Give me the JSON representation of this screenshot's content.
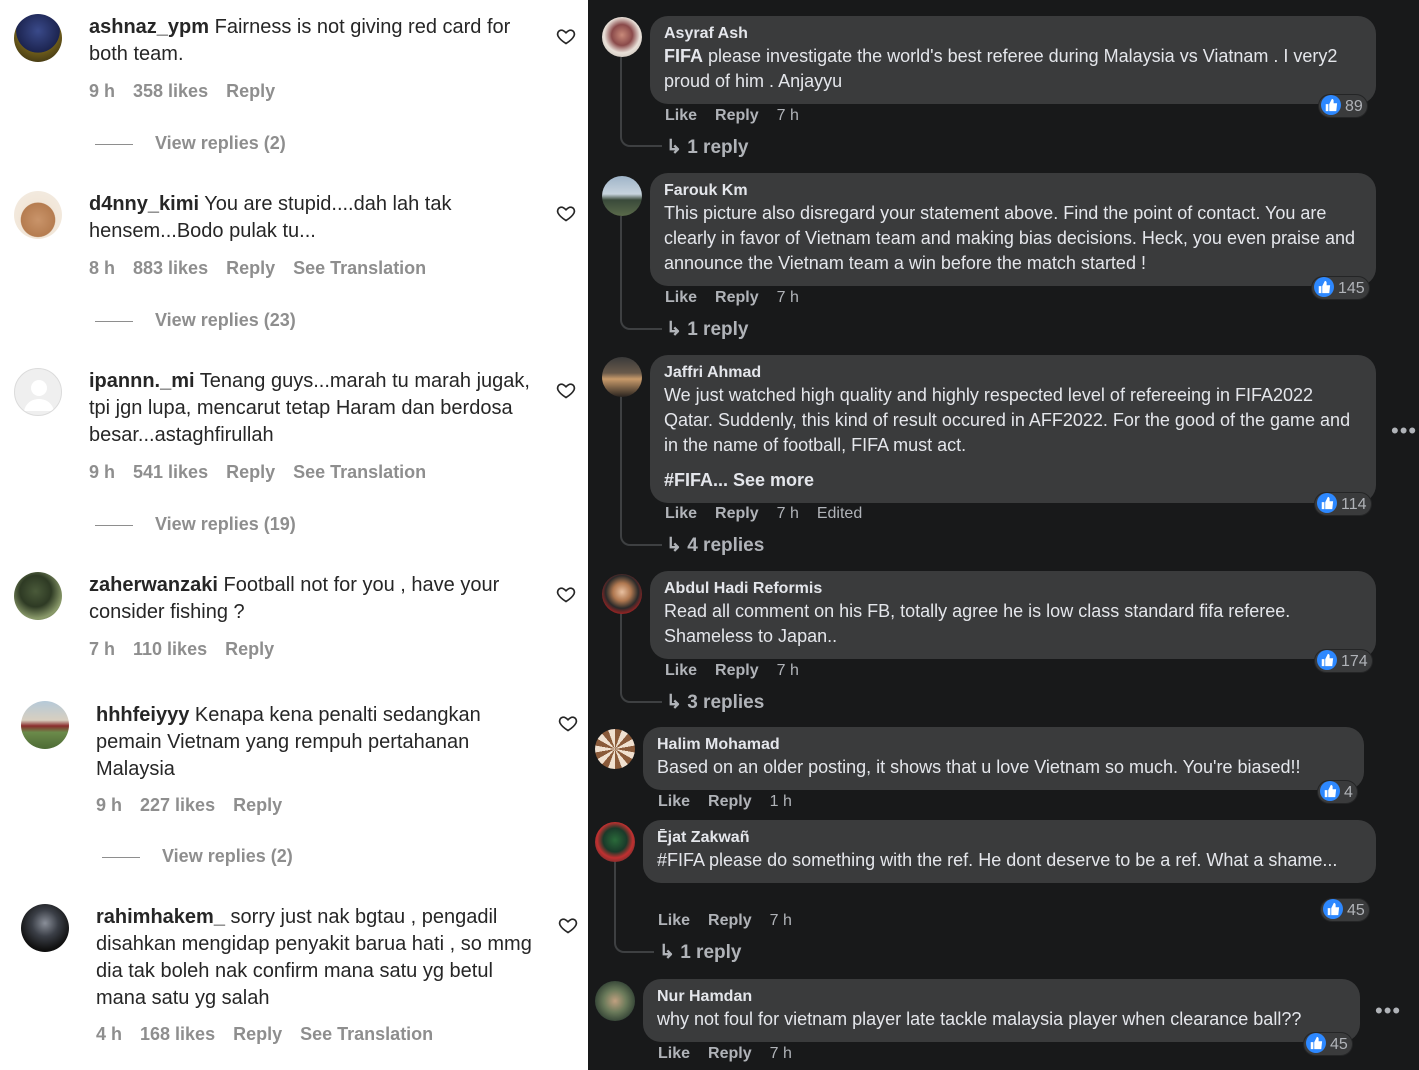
{
  "instagram": {
    "comments": [
      {
        "user": "ashnaz_ypm",
        "text": "Fairness is not giving red card for both team.",
        "time": "9 h",
        "likes": "358 likes",
        "reply": "Reply",
        "translation": "",
        "view_replies": "View replies (2)"
      },
      {
        "user": "d4nny_kimi",
        "text": "You are stupid....dah lah tak hensem...Bodo pulak tu...",
        "time": "8 h",
        "likes": "883 likes",
        "reply": "Reply",
        "translation": "See Translation",
        "view_replies": "View replies (23)"
      },
      {
        "user": "ipannn._mi",
        "text": "Tenang guys...marah tu marah jugak, tpi jgn lupa, mencarut tetap Haram dan berdosa besar...astaghfirullah",
        "time": "9 h",
        "likes": "541 likes",
        "reply": "Reply",
        "translation": "See Translation",
        "view_replies": "View replies (19)"
      },
      {
        "user": "zaherwanzaki",
        "text": "Football not for you , have your consider fishing ?",
        "time": "7 h",
        "likes": "110 likes",
        "reply": "Reply",
        "translation": "",
        "view_replies": ""
      },
      {
        "user": "hhhfeiyyy",
        "text": "Kenapa kena penalti sedangkan pemain Vietnam yang rempuh pertahanan Malaysia",
        "time": "9 h",
        "likes": "227 likes",
        "reply": "Reply",
        "translation": "",
        "view_replies": "View replies (2)"
      },
      {
        "user": "rahimhakem_",
        "text": "sorry just nak bgtau , pengadil disahkan mengidap penyakit barua hati , so mmg dia tak boleh nak confirm mana satu yg betul mana satu yg salah",
        "time": "4 h",
        "likes": "168 likes",
        "reply": "Reply",
        "translation": "See Translation",
        "view_replies": ""
      }
    ]
  },
  "facebook": {
    "comments": [
      {
        "name": "Asyraf Ash",
        "bold_prefix": "FIFA",
        "text": " please investigate the world's best referee during Malaysia vs Viatnam . I very2 proud of him . Anjayyu",
        "extra": "",
        "like": "Like",
        "reply": "Reply",
        "time": "7 h",
        "edited": "",
        "reactions": "89",
        "replies": "1 reply"
      },
      {
        "name": "Farouk Km",
        "bold_prefix": "",
        "text": "This picture also disregard your statement above. Find the point of contact. You are clearly in favor of Vietnam team and making bias decisions. Heck, you even praise and announce the Vietnam team a win before the match started !",
        "extra": "",
        "like": "Like",
        "reply": "Reply",
        "time": "7 h",
        "edited": "",
        "reactions": "145",
        "replies": "1 reply"
      },
      {
        "name": "Jaffri Ahmad",
        "bold_prefix": "",
        "text": "We just watched high quality and highly respected level of refereeing in FIFA2022 Qatar. Suddenly, this kind of result occured in AFF2022. For the good of the game and in the name of football, FIFA must act.",
        "extra": "#FIFA... See more",
        "like": "Like",
        "reply": "Reply",
        "time": "7 h",
        "edited": "Edited",
        "reactions": "114",
        "replies": "4 replies"
      },
      {
        "name": "Abdul Hadi Reformis",
        "bold_prefix": "",
        "text": "Read all comment on his FB, totally agree he is low class standard fifa referee. Shameless to Japan..",
        "extra": "",
        "like": "Like",
        "reply": "Reply",
        "time": "7 h",
        "edited": "",
        "reactions": "174",
        "replies": "3 replies"
      },
      {
        "name": "Halim Mohamad",
        "bold_prefix": "",
        "text": "Based on an older posting, it shows that u love Vietnam so much. You're biased!!",
        "extra": "",
        "like": "Like",
        "reply": "Reply",
        "time": "1 h",
        "edited": "",
        "reactions": "4",
        "replies": ""
      },
      {
        "name": "Ējat Zakwañ",
        "bold_prefix": "#FIFA",
        "text": " please do something with the ref. He dont deserve to be a ref. What a shame...",
        "extra": "",
        "like": "Like",
        "reply": "Reply",
        "time": "7 h",
        "edited": "",
        "reactions": "45",
        "replies": "1 reply"
      },
      {
        "name": "Nur Hamdan",
        "bold_prefix": "",
        "text": "why not foul for vietnam player late tackle malaysia player when clearance ball??",
        "extra": "",
        "like": "Like",
        "reply": "Reply",
        "time": "7 h",
        "edited": "",
        "reactions": "45",
        "replies": ""
      }
    ],
    "more_icon": "•••"
  },
  "colors": {
    "fb_background": "#18191a",
    "fb_bubble": "#3a3b3c",
    "fb_like_blue": "#2d88ff",
    "ig_text": "#262626",
    "ig_meta": "#8e8e8e"
  }
}
